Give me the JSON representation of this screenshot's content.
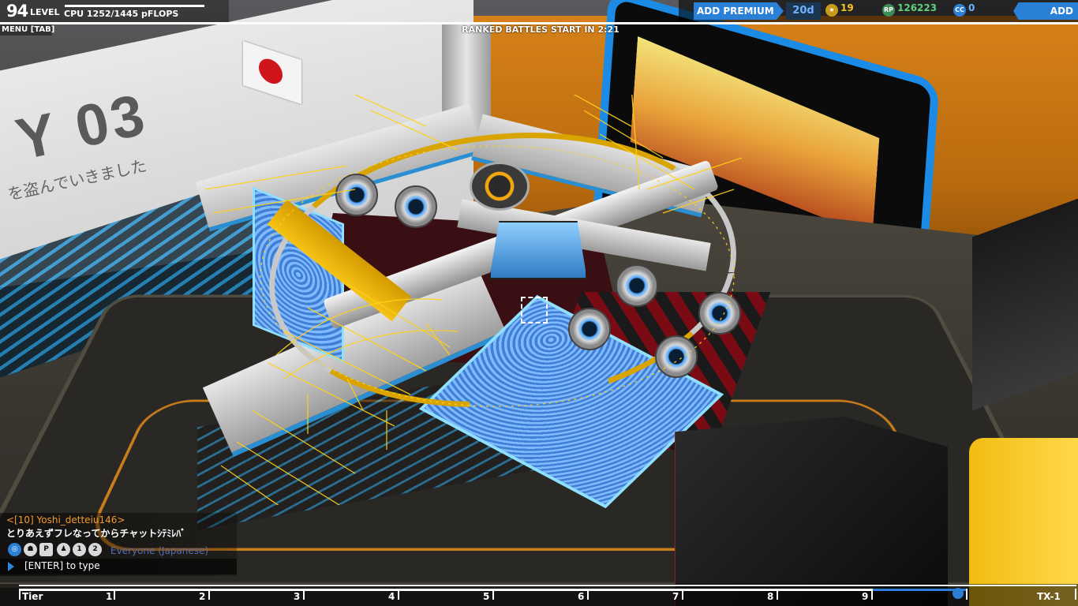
{
  "hud": {
    "level": "94",
    "level_label": "LEVEL",
    "cpu_text": "CPU 1252/1445 pFLOPS",
    "cpu_used": 1252,
    "cpu_max": 1445,
    "menu_label": "MENU [TAB]",
    "ranked_text": "RANKED BATTLES START IN 2:21"
  },
  "topbar": {
    "add_premium": "ADD PREMIUM",
    "premium_days": "20d",
    "tier_points": "19",
    "robits": "126223",
    "cosmetic_credits": "0",
    "add_funds": "ADD FUNDS"
  },
  "icons": {
    "tier_points": "star-icon",
    "robits": "rp-icon",
    "cosmetic_credits": "cc-icon"
  },
  "scene": {
    "bay_text": "Y 03",
    "bay_jp": "を盗んでいきました"
  },
  "chat": {
    "sender": "<[10] Yoshi_detteiu146>",
    "message": "とりあえずフレなってからチャットｼﾃﾐﾚﾊﾞ",
    "channel": "Everyone (Japanese)",
    "input_hint": "[ENTER] to type",
    "party_one": "1",
    "party_two": "2",
    "party_p": "P"
  },
  "tier_bar": {
    "labels": [
      "Tier",
      "1",
      "2",
      "3",
      "4",
      "5",
      "6",
      "7",
      "8",
      "9",
      "",
      "TX-1"
    ]
  },
  "colors": {
    "accent": "#2a7fd6",
    "chat_sender": "#f39a2a",
    "robits_green": "#5fcf7a"
  }
}
